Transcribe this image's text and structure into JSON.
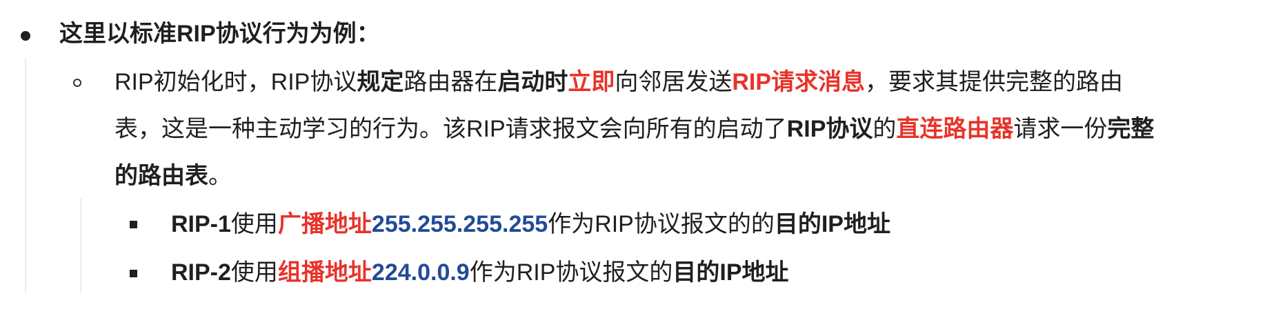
{
  "item1": {
    "text": "这里以标准RIP协议行为为例："
  },
  "item2": {
    "line1": {
      "a": "RIP初始化时，RIP协议",
      "b": "规定",
      "c": "路由器在",
      "d": "启动时",
      "e": "立即",
      "f": "向邻居发送",
      "g": "RIP请求消息",
      "h": "，要求其提供完整的路由"
    },
    "line2": {
      "a": "表，这是一种主动学习的行为。该RIP请求报文会向所有的启动了",
      "b": "RIP协议",
      "c": "的",
      "d": "直连路由器",
      "e": "请求一份",
      "f": "完整"
    },
    "line3": {
      "a": "的路由表",
      "b": "。"
    }
  },
  "sub_items": [
    {
      "label": "RIP-1",
      "verb": "使用",
      "addr_type": "广播地址",
      "addr": "255.255.255.255",
      "mid": "作为RIP协议报文的的",
      "tail": "目的IP地址"
    },
    {
      "label": "RIP-2",
      "verb": "使用",
      "addr_type": "组播地址",
      "addr": "224.0.0.9",
      "mid": "作为RIP协议报文的",
      "tail": "目的IP地址"
    }
  ],
  "colors": {
    "text": "#1f1f1f",
    "highlight_red": "#e8332a",
    "highlight_blue": "#234a97",
    "guide_line": "#ececec"
  }
}
